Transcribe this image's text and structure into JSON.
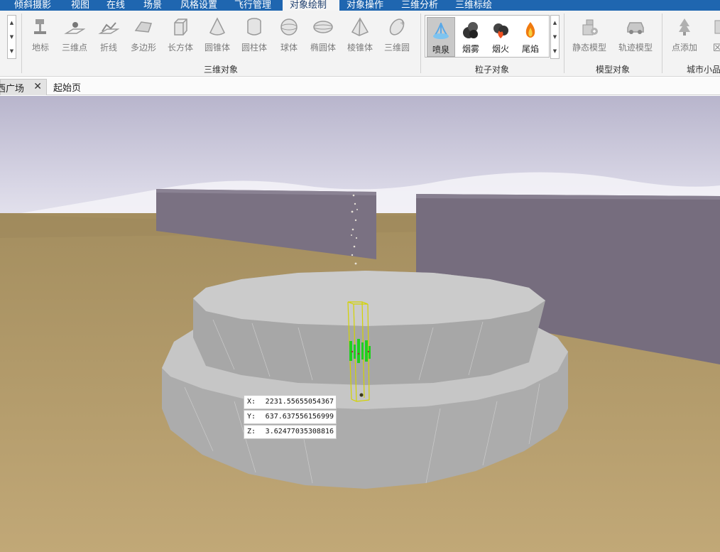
{
  "menu": {
    "tabs": [
      {
        "label": "倾斜摄影"
      },
      {
        "label": "视图"
      },
      {
        "label": "在线"
      },
      {
        "label": "场景"
      },
      {
        "label": "风格设置"
      },
      {
        "label": "飞行管理"
      },
      {
        "label": "对象绘制"
      },
      {
        "label": "对象操作"
      },
      {
        "label": "三维分析"
      },
      {
        "label": "三维标绘"
      }
    ],
    "active_tab": "对象绘制"
  },
  "ribbon": {
    "groups": {
      "objects_3d": {
        "label": "三维对象",
        "buttons": [
          {
            "label": "地标",
            "icon": "landmark-icon"
          },
          {
            "label": "三维点",
            "icon": "3d-point-icon"
          },
          {
            "label": "折线",
            "icon": "polyline-icon"
          },
          {
            "label": "多边形",
            "icon": "polygon-icon"
          },
          {
            "label": "长方体",
            "icon": "cuboid-icon"
          },
          {
            "label": "圆锥体",
            "icon": "cone-icon"
          },
          {
            "label": "圆柱体",
            "icon": "cylinder-icon"
          },
          {
            "label": "球体",
            "icon": "sphere-icon"
          },
          {
            "label": "椭圆体",
            "icon": "ellipsoid-icon"
          },
          {
            "label": "棱锥体",
            "icon": "pyramid-icon"
          },
          {
            "label": "三维圆",
            "icon": "3d-circle-icon"
          }
        ]
      },
      "particles": {
        "label": "粒子对象",
        "items": [
          {
            "label": "喷泉",
            "icon": "fountain-icon",
            "selected": true
          },
          {
            "label": "烟雾",
            "icon": "smoke-icon",
            "selected": false
          },
          {
            "label": "烟火",
            "icon": "firework-icon",
            "selected": false
          },
          {
            "label": "尾焰",
            "icon": "tail-flame-icon",
            "selected": false
          }
        ]
      },
      "models": {
        "label": "模型对象",
        "buttons": [
          {
            "label": "静态模型",
            "icon": "static-model-icon"
          },
          {
            "label": "轨迹模型",
            "icon": "track-model-icon"
          }
        ]
      },
      "city_items": {
        "label": "城市小品",
        "buttons": [
          {
            "label": "点添加",
            "icon": "point-add-icon"
          },
          {
            "label": "区域",
            "icon": "area-add-icon"
          }
        ]
      }
    }
  },
  "doc_tabs": [
    {
      "label": "西广场",
      "closable": true,
      "active": true
    },
    {
      "label": "起始页",
      "closable": false,
      "active": false
    }
  ],
  "viewport": {
    "coords": {
      "x_label": "X:",
      "x": "2231.55655054367",
      "y_label": "Y:",
      "y": "637.637556156999",
      "z_label": "Z:",
      "z": "3.62477035308816"
    },
    "colors": {
      "ground": "#b39a6b",
      "wall": "#797080",
      "platform": "#bdbdbd",
      "selection": "#d3d300",
      "particles": "#1fd01f"
    }
  }
}
